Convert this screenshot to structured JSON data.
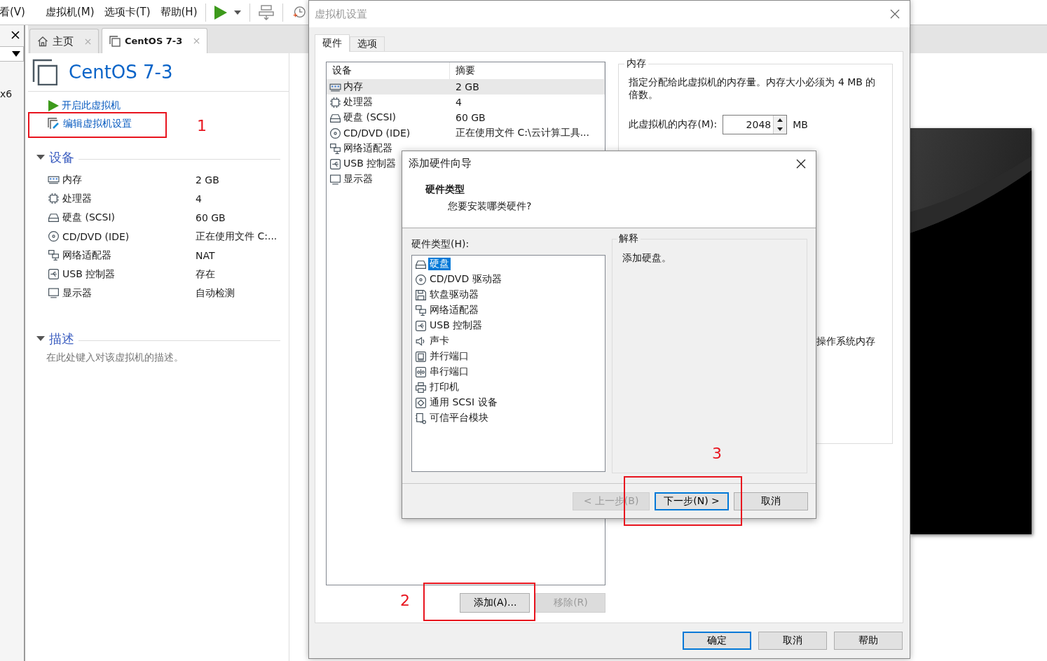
{
  "menu": [
    "看(V)",
    "虚拟机(M)",
    "选项卡(T)",
    "帮助(H)"
  ],
  "side_text": "x6",
  "tabs": [
    {
      "label": "主页",
      "kind": "home",
      "selected": false
    },
    {
      "label": "CentOS 7-3",
      "kind": "vm",
      "selected": true
    }
  ],
  "vm_title": "CentOS 7-3",
  "actions": [
    {
      "label": "开启此虚拟机",
      "kind": "power"
    },
    {
      "label": "编辑虚拟机设置",
      "kind": "edit"
    }
  ],
  "devices_heading": "设备",
  "devices": [
    {
      "kind": "memory",
      "name": "内存",
      "value": "2 GB"
    },
    {
      "kind": "cpu",
      "name": "处理器",
      "value": "4"
    },
    {
      "kind": "disk",
      "name": "硬盘 (SCSI)",
      "value": "60 GB"
    },
    {
      "kind": "cdrom",
      "name": "CD/DVD (IDE)",
      "value": "正在使用文件 C:..."
    },
    {
      "kind": "network",
      "name": "网络适配器",
      "value": "NAT"
    },
    {
      "kind": "usb",
      "name": "USB 控制器",
      "value": "存在"
    },
    {
      "kind": "display",
      "name": "显示器",
      "value": "自动检测"
    }
  ],
  "description_heading": "描述",
  "description_placeholder": "在此处键入对该虚拟机的描述。",
  "settings": {
    "title": "虚拟机设置",
    "tabs": [
      {
        "label": "硬件",
        "selected": true
      },
      {
        "label": "选项",
        "selected": false
      }
    ],
    "columns": [
      "设备",
      "摘要"
    ],
    "rows": [
      {
        "kind": "memory",
        "name": "内存",
        "summary": "2 GB",
        "selected": true
      },
      {
        "kind": "cpu",
        "name": "处理器",
        "summary": "4",
        "selected": false
      },
      {
        "kind": "disk",
        "name": "硬盘 (SCSI)",
        "summary": "60 GB",
        "selected": false
      },
      {
        "kind": "cdrom",
        "name": "CD/DVD (IDE)",
        "summary": "正在使用文件 C:\\云计算工具...",
        "selected": false
      },
      {
        "kind": "network",
        "name": "网络适配器",
        "selected": false
      },
      {
        "kind": "usb",
        "name": "USB 控制器",
        "selected": false
      },
      {
        "kind": "display",
        "name": "显示器",
        "selected": false
      }
    ],
    "list_buttons": [
      {
        "label": "添加(A)...",
        "disabled": false
      },
      {
        "label": "移除(R)",
        "disabled": true
      }
    ],
    "memory": {
      "title": "内存",
      "description": "指定分配给此虚拟机的内存量。内存大小必须为 4 MB 的倍数。",
      "field_label": "此虚拟机的内存(M):",
      "value": "2048",
      "unit": "MB",
      "note": "操作系统内存"
    },
    "buttons": [
      {
        "label": "确定",
        "default": true
      },
      {
        "label": "取消",
        "default": false
      },
      {
        "label": "帮助",
        "default": false
      }
    ]
  },
  "wizard": {
    "title": "添加硬件向导",
    "heading": "硬件类型",
    "subheading": "您要安装哪类硬件?",
    "list_label": "硬件类型(H):",
    "items": [
      {
        "kind": "disk",
        "label": "硬盘",
        "selected": true
      },
      {
        "kind": "cdrom",
        "label": "CD/DVD 驱动器",
        "selected": false
      },
      {
        "kind": "floppy",
        "label": "软盘驱动器",
        "selected": false
      },
      {
        "kind": "network",
        "label": "网络适配器",
        "selected": false
      },
      {
        "kind": "usb",
        "label": "USB 控制器",
        "selected": false
      },
      {
        "kind": "sound",
        "label": "声卡",
        "selected": false
      },
      {
        "kind": "parallel",
        "label": "并行端口",
        "selected": false
      },
      {
        "kind": "serial",
        "label": "串行端口",
        "selected": false
      },
      {
        "kind": "printer",
        "label": "打印机",
        "selected": false
      },
      {
        "kind": "scsi",
        "label": "通用 SCSI 设备",
        "selected": false
      },
      {
        "kind": "tpm",
        "label": "可信平台模块",
        "selected": false
      }
    ],
    "explanation_title": "解释",
    "explanation": "添加硬盘。",
    "buttons": [
      {
        "label": "< 上一步(B)",
        "disabled": true,
        "default": false
      },
      {
        "label": "下一步(N) >",
        "disabled": false,
        "default": true
      },
      {
        "label": "取消",
        "disabled": false,
        "default": false
      }
    ]
  },
  "annotations": [
    {
      "label": "1"
    },
    {
      "label": "2"
    },
    {
      "label": "3"
    }
  ]
}
